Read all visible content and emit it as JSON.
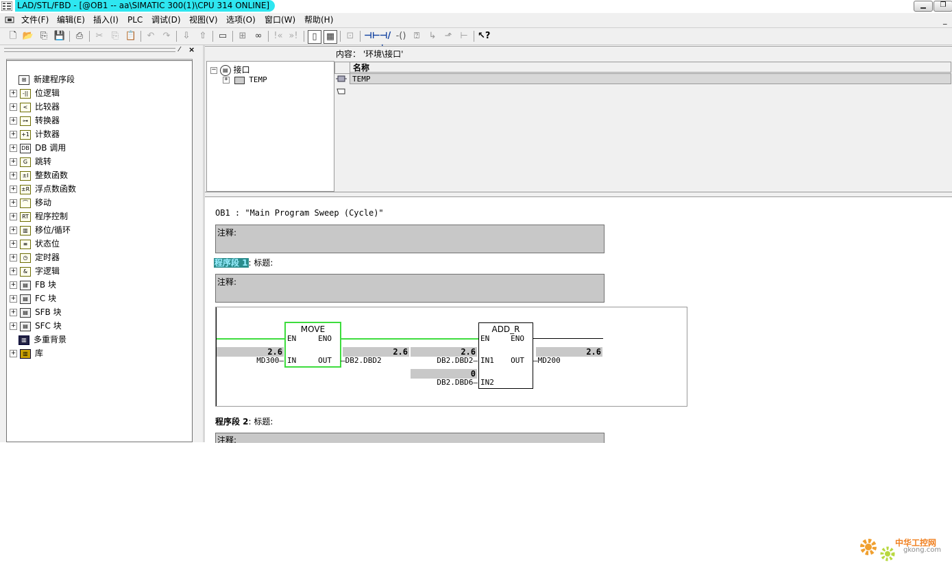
{
  "window": {
    "title": "LAD/STL/FBD  - [@OB1 -- aa\\SIMATIC 300(1)\\CPU 314  ONLINE]"
  },
  "menu": [
    "文件(F)",
    "编辑(E)",
    "插入(I)",
    "PLC",
    "调试(D)",
    "视图(V)",
    "选项(O)",
    "窗口(W)",
    "帮助(H)"
  ],
  "catalog": {
    "items": [
      "新建程序段",
      "位逻辑",
      "比较器",
      "转换器",
      "计数器",
      "DB 调用",
      "跳转",
      "整数函数",
      "浮点数函数",
      "移动",
      "程序控制",
      "移位/循环",
      "状态位",
      "定时器",
      "字逻辑",
      "FB 块",
      "FC 块",
      "SFB 块",
      "SFC 块",
      "多重背景",
      "库"
    ]
  },
  "interface": {
    "root": "接口",
    "child": "TEMP",
    "content_label": "内容：  '环境\\接口'",
    "col_name": "名称",
    "row1": "TEMP"
  },
  "code": {
    "block_header": "OB1 :  \"Main Program Sweep (Cycle)\"",
    "comment_label": "注释:",
    "network1_label": "程序段 1",
    "network1_title": ": 标题:",
    "network2_label": "程序段  2",
    "network2_title": ": 标题:",
    "move": {
      "name": "MOVE",
      "en": "EN",
      "eno": "ENO",
      "in": "IN",
      "out": "OUT",
      "in_addr": "MD300",
      "in_val": "2.6",
      "out_addr": "DB2.DBD2",
      "out_val": "2.6"
    },
    "add": {
      "name": "ADD_R",
      "en": "EN",
      "eno": "ENO",
      "in1": "IN1",
      "in2": "IN2",
      "out": "OUT",
      "in1_addr": "DB2.DBD2",
      "in1_val": "2.6",
      "in2_addr": "DB2.DBD6",
      "in2_val": "0",
      "out_addr": "MD200",
      "out_val": "2.6"
    }
  },
  "watermark": {
    "cn": "中华工控网",
    "url": "gkong.com"
  }
}
